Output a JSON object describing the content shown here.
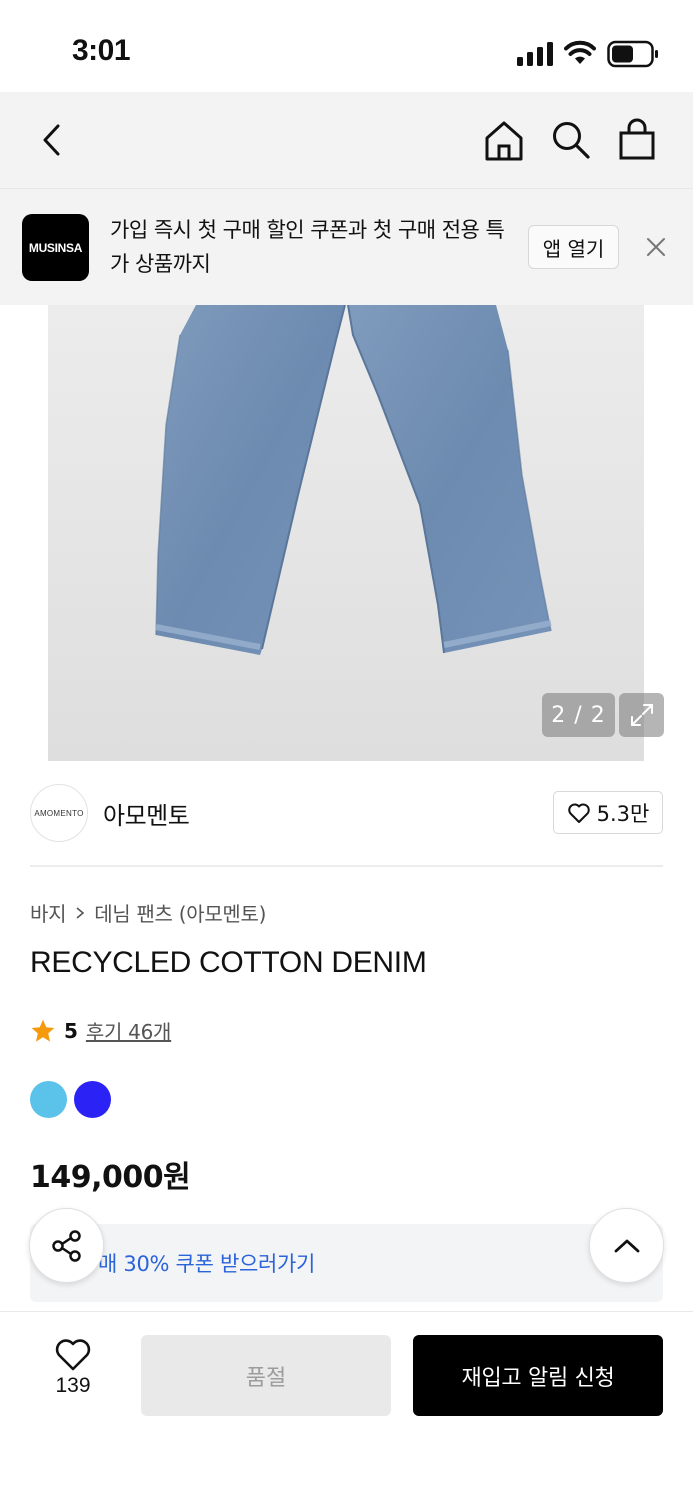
{
  "status_bar": {
    "time": "3:01"
  },
  "nav": {
    "back": "back-icon",
    "home": "home-icon",
    "search": "search-icon",
    "cart": "shopping-bag-icon"
  },
  "app_banner": {
    "logo_text": "MUSINSA",
    "message": "가입 즉시 첫 구매 할인 쿠폰과 첫 구매 전용 특가 상품까지",
    "open_app_label": "앱 열기"
  },
  "gallery": {
    "counter": "2 / 2"
  },
  "brand": {
    "logo_text": "AMOMENTO",
    "name": "아모멘토",
    "like_count": "5.3만"
  },
  "product": {
    "breadcrumb": [
      "바지",
      "데님 팬츠 (아모멘토)"
    ],
    "title": "RECYCLED COTTON DENIM",
    "rating": "5",
    "reviews_label": "후기 46개",
    "colors": [
      "#5bc2ea",
      "#2b22f5"
    ],
    "price": "149,000원"
  },
  "coupon": {
    "text": "매 30% 쿠폰 받으러가기"
  },
  "bottom_bar": {
    "like_count": "139",
    "soldout_label": "품절",
    "restock_label": "재입고 알림 신청"
  }
}
